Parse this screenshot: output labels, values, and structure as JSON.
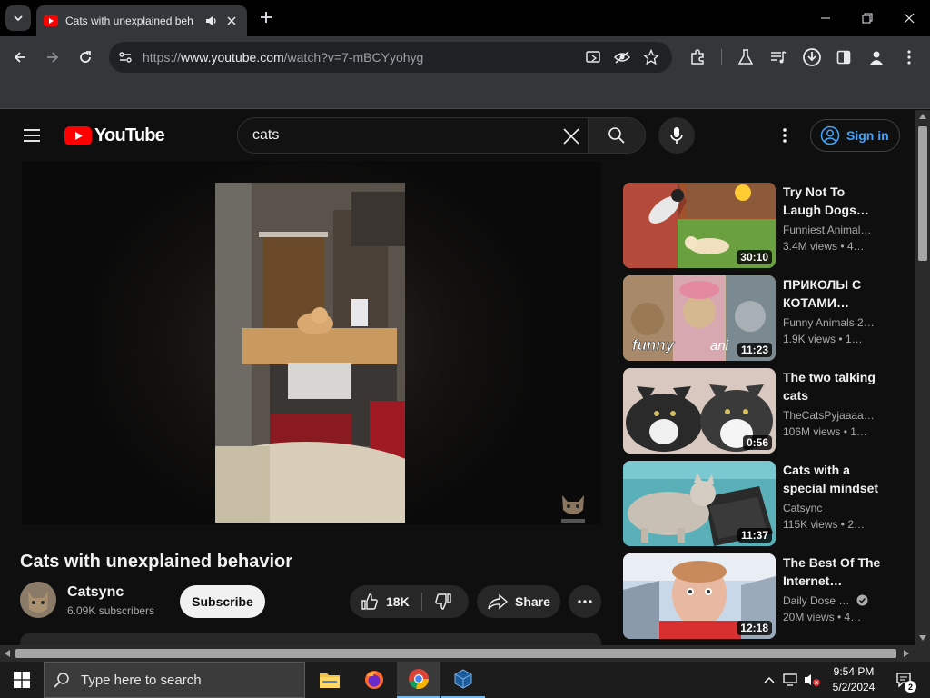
{
  "browser": {
    "tab_title": "Cats with unexplained beh",
    "url_scheme": "https://",
    "url_host": "www.youtube.com",
    "url_path": "/watch?v=7-mBCYyohyg"
  },
  "youtube": {
    "logo_text": "YouTube",
    "search_query": "cats",
    "sign_in": "Sign in"
  },
  "video": {
    "title": "Cats with unexplained behavior",
    "channel": "Catsync",
    "subscribers": "6.09K subscribers",
    "subscribe_label": "Subscribe",
    "likes": "18K",
    "share_label": "Share"
  },
  "related": [
    {
      "title": "Try Not To Laugh Dogs…",
      "channel": "Funniest Animal…",
      "meta": "3.4M views • 4…",
      "duration": "30:10"
    },
    {
      "title": "ПРИКОЛЫ С КОТАМИ…",
      "channel": "Funny Animals 2…",
      "meta": "1.9K views • 1…",
      "duration": "11:23",
      "overlay_text": "funny",
      "overlay_text_2": "ani"
    },
    {
      "title": "The two talking cats",
      "channel": "TheCatsPyjaaaa…",
      "meta": "106M views • 1…",
      "duration": "0:56"
    },
    {
      "title": "Cats with a special mindset",
      "channel": "Catsync",
      "meta": "115K views • 2…",
      "duration": "11:37"
    },
    {
      "title": "The Best Of The Internet…",
      "channel": "Daily Dose …",
      "meta": "20M views • 4…",
      "duration": "12:18",
      "verified": true
    }
  ],
  "taskbar": {
    "search_placeholder": "Type here to search",
    "time": "9:54 PM",
    "date": "5/2/2024",
    "notification_count": "2"
  },
  "colors": {
    "accent_red": "#ff0000",
    "link_blue": "#3ea6ff",
    "page_bg": "#0f0f0f"
  }
}
